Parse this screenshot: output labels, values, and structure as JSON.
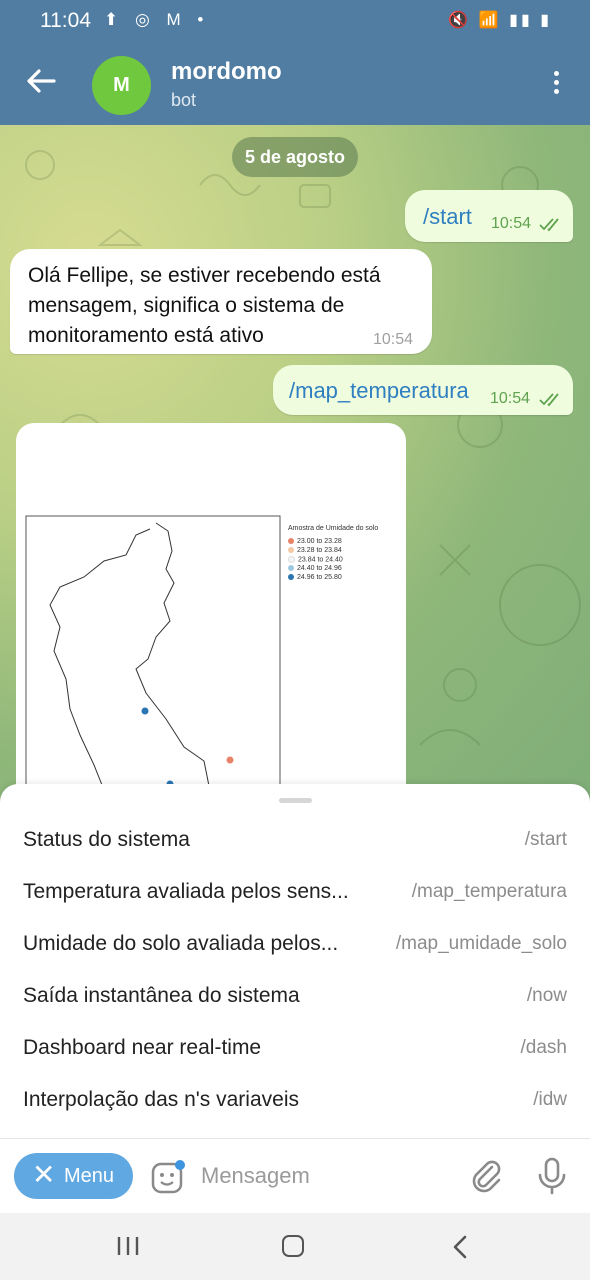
{
  "status_bar": {
    "time": "11:04",
    "left_icons": "⬆ ◎ M •",
    "right_icons": "🔇 📶 ▮▮ ▮"
  },
  "header": {
    "title": "mordomo",
    "subtitle": "bot",
    "avatar_letter": "M"
  },
  "chat": {
    "date_chip": "5 de agosto",
    "messages": [
      {
        "direction": "out",
        "text": "/start",
        "time": "10:54"
      },
      {
        "direction": "in",
        "text": "Olá Fellipe, se estiver recebendo está mensagem, significa o sistema de monitoramento está ativo",
        "time": "10:54"
      },
      {
        "direction": "out",
        "text": "/map_temperatura",
        "time": "10:54"
      }
    ],
    "map_image": {
      "legend_title": "Amostra de Umidade do solo",
      "legend": [
        {
          "label": "23.00 to 23.28",
          "color": "#e8836a"
        },
        {
          "label": "23.28 to 23.84",
          "color": "#f5c9a4"
        },
        {
          "label": "23.84 to 24.40",
          "color": "#f4f4f4"
        },
        {
          "label": "24.40 to 24.96",
          "color": "#9cc8e0"
        },
        {
          "label": "24.96 to 25.80",
          "color": "#2b75b3"
        }
      ]
    }
  },
  "commands": [
    {
      "description": "Status do sistema",
      "command": "/start"
    },
    {
      "description": "Temperatura avaliada pelos sens...",
      "command": "/map_temperatura"
    },
    {
      "description": "Umidade do solo avaliada pelos...",
      "command": "/map_umidade_solo"
    },
    {
      "description": "Saída instantânea do sistema",
      "command": "/now"
    },
    {
      "description": "Dashboard near real-time",
      "command": "/dash"
    },
    {
      "description": "Interpolação das n's variaveis",
      "command": "/idw"
    }
  ],
  "input": {
    "menu_label": "Menu",
    "placeholder": "Mensagem"
  },
  "colors": {
    "header": "#517da2",
    "accent": "#5fa8e2",
    "out_bubble": "#effdde",
    "command_link": "#2f7fc1"
  }
}
